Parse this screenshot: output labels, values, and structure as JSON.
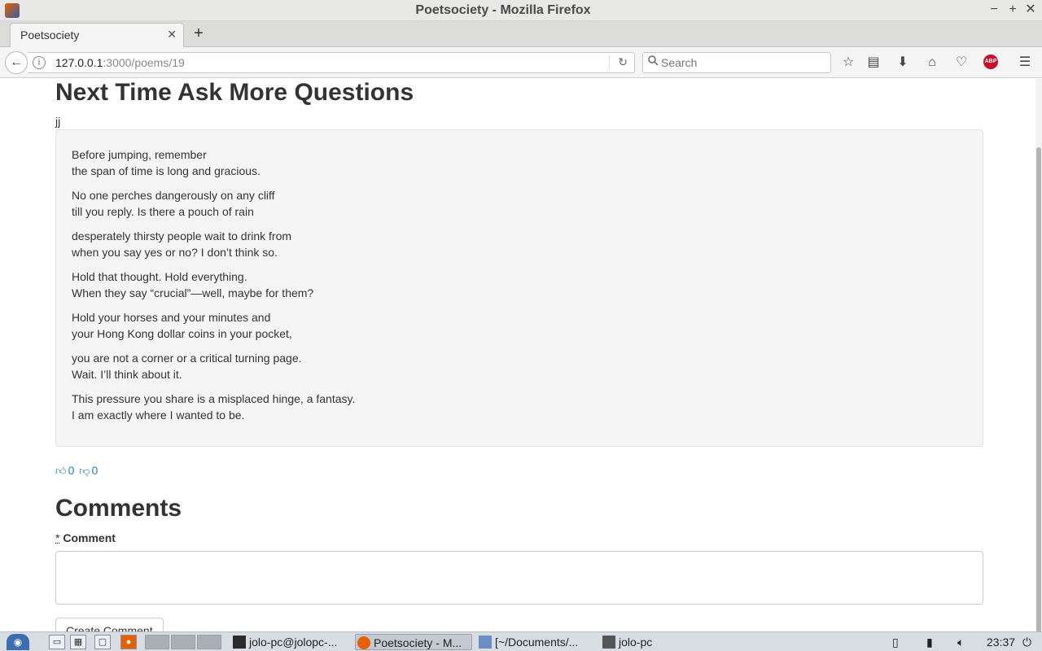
{
  "window": {
    "title": "Poetsociety - Mozilla Firefox"
  },
  "tabs": [
    {
      "label": "Poetsociety"
    }
  ],
  "urlbar": {
    "host": "127.0.0.1",
    "rest": ":3000/poems/19"
  },
  "search": {
    "placeholder": "Search"
  },
  "poem": {
    "title": "Next Time Ask More Questions",
    "author": "jj",
    "stanzas": [
      [
        "Before jumping, remember",
        "the span of time is long and gracious."
      ],
      [
        "No one perches dangerously on any cliff",
        "till you reply. Is there a pouch of rain"
      ],
      [
        "desperately thirsty people wait to drink from",
        "when you say yes or no? I don’t think so."
      ],
      [
        "Hold that thought. Hold everything.",
        "When they say “crucial”—well, maybe for them?"
      ],
      [
        "Hold your horses and your minutes and",
        "your Hong Kong dollar coins in your pocket,"
      ],
      [
        "you are not a corner or a critical turning page.",
        "Wait. I’ll think about it."
      ],
      [
        "This pressure you share is a misplaced hinge, a fantasy.",
        "I am exactly where I wanted to be."
      ]
    ],
    "likes": "0",
    "dislikes": "0"
  },
  "comments": {
    "heading": "Comments",
    "required_mark": "*",
    "label": "Comment",
    "submit_label": "Create Comment"
  },
  "taskbar": {
    "tasks": [
      {
        "label": "jolo-pc@jolopc-..."
      },
      {
        "label": "Poetsociety - M..."
      },
      {
        "label": "[~/Documents/..."
      },
      {
        "label": "jolo-pc"
      }
    ],
    "clock": "23:37"
  },
  "colors": {
    "link": "#337ab7",
    "well_bg": "#f5f5f5",
    "abp": "#c70d2c"
  }
}
